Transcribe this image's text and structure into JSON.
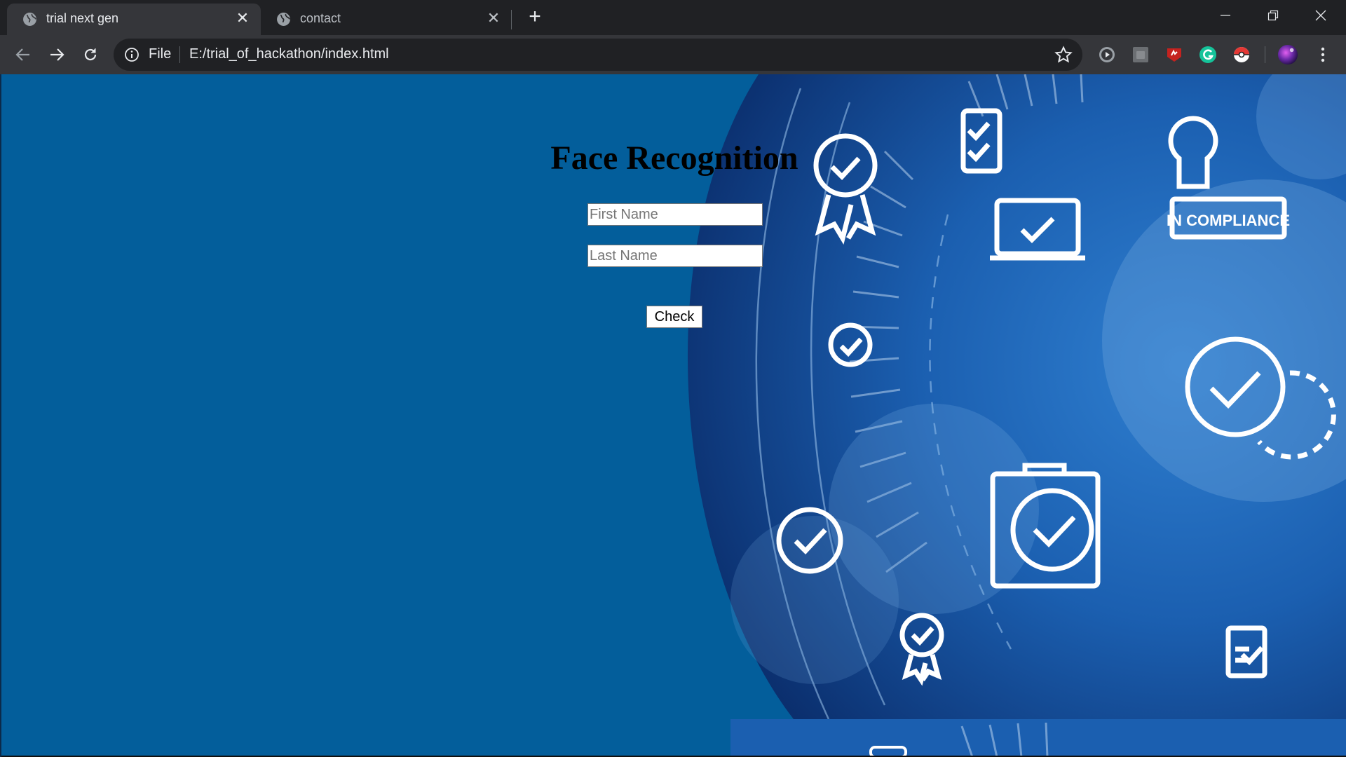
{
  "tabs": [
    {
      "title": "trial next gen",
      "active": true
    },
    {
      "title": "contact",
      "active": false
    }
  ],
  "address_bar": {
    "scheme_label": "File",
    "url": "E:/trial_of_hackathon/index.html"
  },
  "page": {
    "heading": "Face Recognition",
    "first_name_placeholder": "First Name",
    "last_name_placeholder": "Last Name",
    "check_label": "Check",
    "background_color": "#035e9b",
    "compliance_stamp_text": "IN COMPLIANCE"
  },
  "icons": {
    "tab_favicon": "globe-icon",
    "tab_close": "close-icon",
    "new_tab": "plus-icon",
    "back": "arrow-left-icon",
    "forward": "arrow-right-icon",
    "reload": "reload-icon",
    "info": "info-icon",
    "bookmark": "star-icon",
    "extensions": [
      "play-extension-icon",
      "square-extension-icon",
      "red-extension-icon",
      "grammarly-icon",
      "pokeball-extension-icon"
    ],
    "profile": "avatar",
    "menu": "kebab-menu-icon"
  },
  "colors": {
    "titlebar": "#202124",
    "toolbar": "#35363a",
    "text": "#e8eaed"
  }
}
